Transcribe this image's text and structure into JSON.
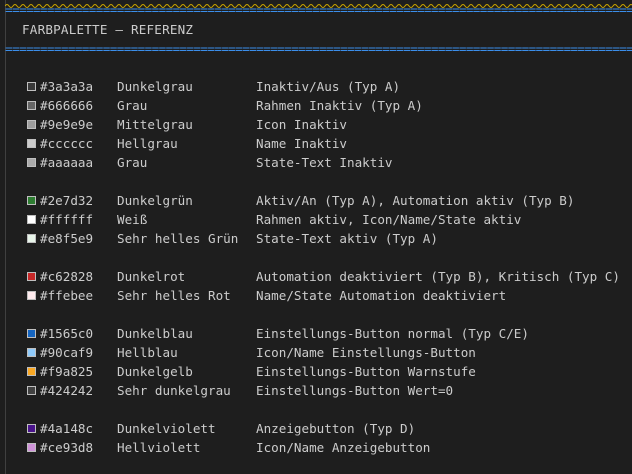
{
  "header": {
    "separator": "==============================================================================================",
    "title": "FARBPALETTE – REFERENZ"
  },
  "groups": [
    {
      "rows": [
        {
          "hex": "#3a3a3a",
          "name": "Dunkelgrau",
          "usage": "Inaktiv/Aus (Typ A)",
          "color": "#3a3a3a"
        },
        {
          "hex": "#666666",
          "name": "Grau",
          "usage": "Rahmen Inaktiv (Typ A)",
          "color": "#666666"
        },
        {
          "hex": "#9e9e9e",
          "name": "Mittelgrau",
          "usage": "Icon Inaktiv",
          "color": "#9e9e9e"
        },
        {
          "hex": "#cccccc",
          "name": "Hellgrau",
          "usage": "Name Inaktiv",
          "color": "#cccccc"
        },
        {
          "hex": "#aaaaaa",
          "name": "Grau",
          "usage": "State-Text Inaktiv",
          "color": "#aaaaaa"
        }
      ]
    },
    {
      "rows": [
        {
          "hex": "#2e7d32",
          "name": "Dunkelgrün",
          "usage": "Aktiv/An (Typ A), Automation aktiv (Typ B)",
          "color": "#2e7d32"
        },
        {
          "hex": "#ffffff",
          "name": "Weiß",
          "usage": "Rahmen aktiv, Icon/Name/State aktiv",
          "color": "#ffffff"
        },
        {
          "hex": "#e8f5e9",
          "name": "Sehr helles Grün",
          "usage": "State-Text aktiv (Typ A)",
          "color": "#e8f5e9"
        }
      ]
    },
    {
      "rows": [
        {
          "hex": "#c62828",
          "name": "Dunkelrot",
          "usage": "Automation deaktiviert (Typ B), Kritisch (Typ C)",
          "color": "#c62828"
        },
        {
          "hex": "#ffebee",
          "name": "Sehr helles Rot",
          "usage": "Name/State Automation deaktiviert",
          "color": "#ffebee"
        }
      ]
    },
    {
      "rows": [
        {
          "hex": "#1565c0",
          "name": "Dunkelblau",
          "usage": "Einstellungs-Button normal (Typ C/E)",
          "color": "#1565c0"
        },
        {
          "hex": "#90caf9",
          "name": "Hellblau",
          "usage": "Icon/Name Einstellungs-Button",
          "color": "#90caf9"
        },
        {
          "hex": "#f9a825",
          "name": "Dunkelgelb",
          "usage": "Einstellungs-Button Warnstufe",
          "color": "#f9a825"
        },
        {
          "hex": "#424242",
          "name": "Sehr dunkelgrau",
          "usage": "Einstellungs-Button Wert=0",
          "color": "#424242"
        }
      ]
    },
    {
      "rows": [
        {
          "hex": "#4a148c",
          "name": "Dunkelviolett",
          "usage": "Anzeigebutton (Typ D)",
          "color": "#4a148c"
        },
        {
          "hex": "#ce93d8",
          "name": "Hellviolett",
          "usage": "Icon/Name Anzeigebutton",
          "color": "#ce93d8"
        }
      ]
    }
  ],
  "colors": {
    "background": "#1e1e1e",
    "separator": "#3b8eea",
    "text": "#cccccc",
    "warning_underline": "#cca700"
  }
}
